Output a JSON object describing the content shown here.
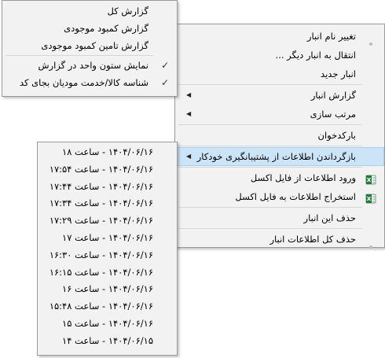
{
  "report_menu": {
    "items": [
      {
        "label": "گزارش کل"
      },
      {
        "label": "گزارش کمبود موجودی"
      },
      {
        "label": "گزارش تامین کمبود موجودی"
      }
    ],
    "options": [
      {
        "label": "نمایش ستون واحد در گزارش",
        "checked": true
      },
      {
        "label": "شناسه کالا/خدمت مودیان بجای کد",
        "checked": true
      }
    ]
  },
  "main_menu": {
    "rename": "تغییر نام انبار",
    "move": "انتقال به انبار دیگر ...",
    "new": "انبار جدید",
    "report": "گزارش انبار",
    "sort": "مرتب سازی",
    "barcode": "بارکدخوان",
    "restore": "بازگرداندن اطلاعات از پشتیبانگیری خودکار",
    "import_excel": "ورود اطلاعات از فایل اکسل",
    "export_excel": "استخراج اطلاعات به فایل اکسل",
    "delete": "حذف این انبار",
    "delete_all": "حذف کل اطلاعات انبار"
  },
  "backup_menu": {
    "items": [
      {
        "label": "۱۴۰۴/۰۶/۱۶ - ساعت ۱۸"
      },
      {
        "label": "۱۴۰۴/۰۶/۱۶ - ساعت ۱۷:۵۴"
      },
      {
        "label": "۱۴۰۴/۰۶/۱۶ - ساعت ۱۷:۴۴"
      },
      {
        "label": "۱۴۰۴/۰۶/۱۶ - ساعت ۱۷:۳۴"
      },
      {
        "label": "۱۴۰۴/۰۶/۱۶ - ساعت ۱۷:۲۹"
      },
      {
        "label": "۱۴۰۴/۰۶/۱۶ - ساعت ۱۷"
      },
      {
        "label": "۱۴۰۴/۰۶/۱۶ - ساعت ۱۶:۳۰"
      },
      {
        "label": "۱۴۰۴/۰۶/۱۶ - ساعت ۱۶:۱۵"
      },
      {
        "label": "۱۴۰۴/۰۶/۱۶ - ساعت ۱۶"
      },
      {
        "label": "۱۴۰۴/۰۶/۱۶ - ساعت ۱۵:۴۸"
      },
      {
        "label": "۱۴۰۴/۰۶/۱۶ - ساعت ۱۵"
      },
      {
        "label": "۱۴۰۴/۰۶/۱۵ - ساعت ۱۴"
      }
    ]
  },
  "icons": {
    "submenu_arrow": "submenu-arrow-icon",
    "check": "check-icon",
    "excel": "excel-icon"
  },
  "colors": {
    "menu_bg": "#f2f2f2",
    "highlight": "#cce4f7",
    "excel_green": "#1f7a3a"
  }
}
